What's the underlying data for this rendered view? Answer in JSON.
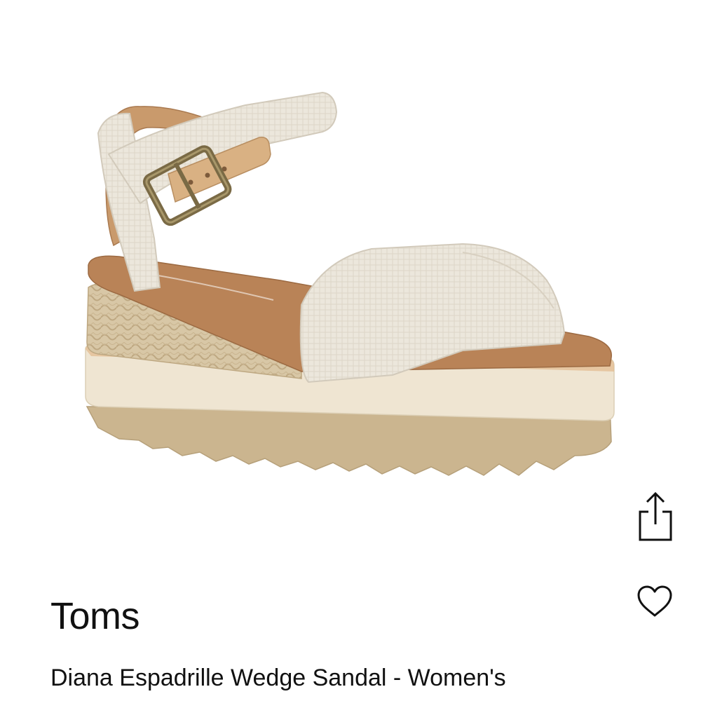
{
  "product": {
    "brand": "Toms",
    "name": "Diana Espadrille Wedge Sandal - Women's"
  },
  "actions": {
    "share_icon": "share-icon",
    "favorite_icon": "heart-outline-icon"
  },
  "colors": {
    "text": "#111111",
    "background": "#ffffff",
    "canvas_strap": "#ece7dc",
    "footbed": "#b98357",
    "jute": "#d8c7a6",
    "midsole": "#efe5d2",
    "outsole": "#cbb58f",
    "buckle": "#7a6a45"
  }
}
